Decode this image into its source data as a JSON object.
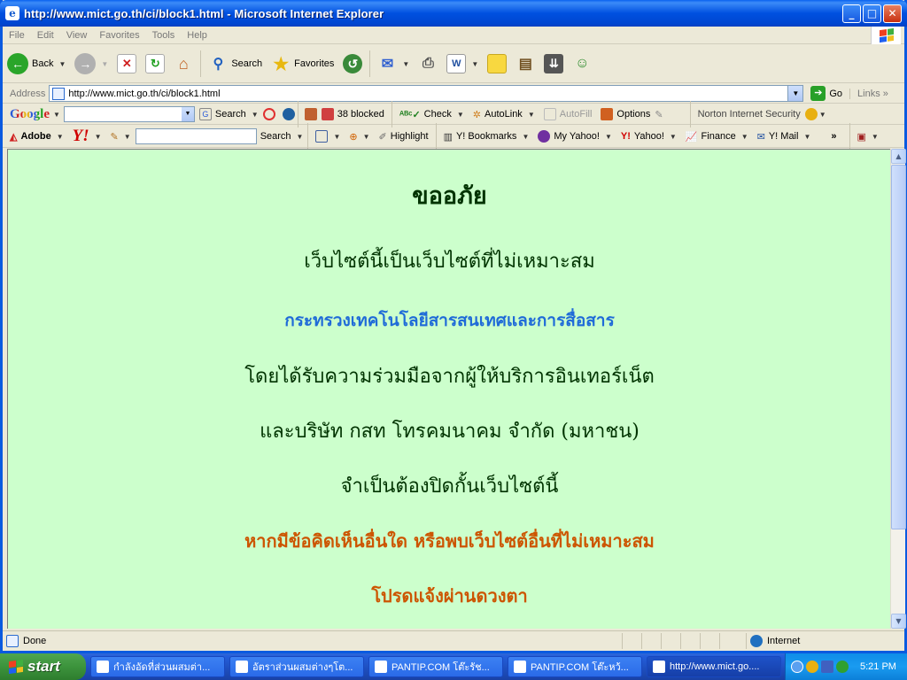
{
  "window": {
    "title": "http://www.mict.go.th/ci/block1.html - Microsoft Internet Explorer",
    "minimize": "_",
    "maximize": "□",
    "close": "✕"
  },
  "menu": [
    "File",
    "Edit",
    "View",
    "Favorites",
    "Tools",
    "Help"
  ],
  "toolbar": {
    "back_label": "Back",
    "search_label": "Search",
    "favorites_label": "Favorites"
  },
  "address": {
    "label": "Address",
    "url": "http://www.mict.go.th/ci/block1.html",
    "go_label": "Go",
    "links_label": "Links"
  },
  "google_toolbar": {
    "logo": "Google",
    "search_label": "Search",
    "blocked_label": "38 blocked",
    "check_label": "Check",
    "autolink_label": "AutoLink",
    "autofill_label": "AutoFill",
    "options_label": "Options",
    "norton_label": "Norton Internet Security"
  },
  "adobe_toolbar": {
    "adobe_label": "Adobe",
    "yahoo_logo": "Y!",
    "search_label": "Search",
    "highlight_label": "Highlight",
    "bookmarks_label": "Y! Bookmarks",
    "myyahoo_label": "My Yahoo!",
    "yahoo_label": "Yahoo!",
    "finance_label": "Finance",
    "mail_label": "Y! Mail"
  },
  "page": {
    "heading": "ขออภัย",
    "line1": "เว็บไซต์นี้เป็นเว็บไซต์ที่ไม่เหมาะสม",
    "line2": "กระทรวงเทคโนโลยีสารสนเทศและการสื่อสาร",
    "line3": "โดยได้รับความร่วมมือจากผู้ให้บริการอินเทอร์เน็ต",
    "line4": "และบริษัท กสท โทรคมนาคม จำกัด (มหาชน)",
    "line5": "จำเป็นต้องปิดกั้นเว็บไซต์นี้",
    "line6": "หากมีข้อคิดเห็นอื่นใด หรือพบเว็บไซต์อื่นที่ไม่เหมาะสม",
    "line7": "โปรดแจ้งผ่านดวงตา"
  },
  "status": {
    "text": "Done",
    "zone": "Internet"
  },
  "taskbar": {
    "start_label": "start",
    "tasks": [
      "กำลังอัดที่ส่วนผสมต่า...",
      "อัตราส่วนผสมต่างๆโต...",
      "PANTIP.COM โต๊ะรัช...",
      "PANTIP.COM โต๊ะหว้...",
      "http://www.mict.go...."
    ],
    "clock": "5:21 PM"
  },
  "colors": {
    "page_bg": "#ccffcc",
    "heading": "#003300",
    "ministry": "#1f6bd8",
    "notice": "#cc5500"
  }
}
